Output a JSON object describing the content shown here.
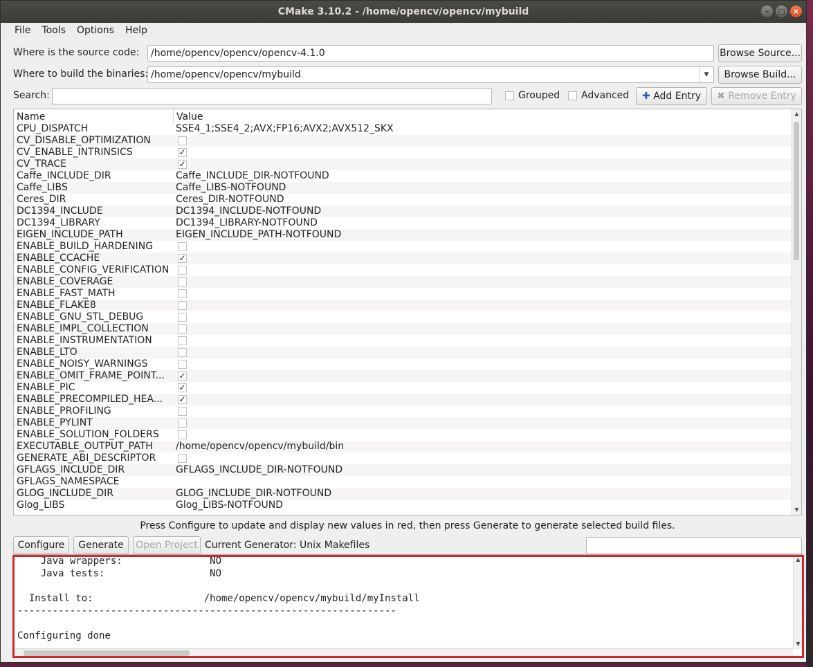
{
  "window": {
    "title": "CMake 3.10.2 - /home/opencv/opencv/mybuild"
  },
  "menu": [
    {
      "label": "File"
    },
    {
      "label": "Tools"
    },
    {
      "label": "Options"
    },
    {
      "label": "Help"
    }
  ],
  "source": {
    "label": "Where is the source code:",
    "value": "/home/opencv/opencv/opencv-4.1.0",
    "browse_label": "Browse Source..."
  },
  "build": {
    "label": "Where to build the binaries:",
    "value": "/home/opencv/opencv/mybuild",
    "browse_label": "Browse Build..."
  },
  "search": {
    "label": "Search:",
    "value": "",
    "grouped_label": "Grouped",
    "grouped_checked": false,
    "advanced_label": "Advanced",
    "advanced_checked": false,
    "add_entry_label": "Add Entry",
    "remove_entry_label": "Remove Entry"
  },
  "table": {
    "columns": [
      "Name",
      "Value"
    ],
    "rows": [
      {
        "name": "CPU_DISPATCH",
        "value": "SSE4_1;SSE4_2;AVX;FP16;AVX2;AVX512_SKX"
      },
      {
        "name": "CV_DISABLE_OPTIMIZATION",
        "checked": false
      },
      {
        "name": "CV_ENABLE_INTRINSICS",
        "checked": true
      },
      {
        "name": "CV_TRACE",
        "checked": true
      },
      {
        "name": "Caffe_INCLUDE_DIR",
        "value": "Caffe_INCLUDE_DIR-NOTFOUND"
      },
      {
        "name": "Caffe_LIBS",
        "value": "Caffe_LIBS-NOTFOUND"
      },
      {
        "name": "Ceres_DIR",
        "value": "Ceres_DIR-NOTFOUND"
      },
      {
        "name": "DC1394_INCLUDE",
        "value": "DC1394_INCLUDE-NOTFOUND"
      },
      {
        "name": "DC1394_LIBRARY",
        "value": "DC1394_LIBRARY-NOTFOUND"
      },
      {
        "name": "EIGEN_INCLUDE_PATH",
        "value": "EIGEN_INCLUDE_PATH-NOTFOUND"
      },
      {
        "name": "ENABLE_BUILD_HARDENING",
        "checked": false
      },
      {
        "name": "ENABLE_CCACHE",
        "checked": true
      },
      {
        "name": "ENABLE_CONFIG_VERIFICATION",
        "checked": false
      },
      {
        "name": "ENABLE_COVERAGE",
        "checked": false
      },
      {
        "name": "ENABLE_FAST_MATH",
        "checked": false
      },
      {
        "name": "ENABLE_FLAKE8",
        "checked": false
      },
      {
        "name": "ENABLE_GNU_STL_DEBUG",
        "checked": false
      },
      {
        "name": "ENABLE_IMPL_COLLECTION",
        "checked": false
      },
      {
        "name": "ENABLE_INSTRUMENTATION",
        "checked": false
      },
      {
        "name": "ENABLE_LTO",
        "checked": false
      },
      {
        "name": "ENABLE_NOISY_WARNINGS",
        "checked": false
      },
      {
        "name": "ENABLE_OMIT_FRAME_POINT...",
        "checked": true
      },
      {
        "name": "ENABLE_PIC",
        "checked": true
      },
      {
        "name": "ENABLE_PRECOMPILED_HEA...",
        "checked": true
      },
      {
        "name": "ENABLE_PROFILING",
        "checked": false
      },
      {
        "name": "ENABLE_PYLINT",
        "checked": false
      },
      {
        "name": "ENABLE_SOLUTION_FOLDERS",
        "checked": false
      },
      {
        "name": "EXECUTABLE_OUTPUT_PATH",
        "value": "/home/opencv/opencv/mybuild/bin"
      },
      {
        "name": "GENERATE_ABI_DESCRIPTOR",
        "checked": false
      },
      {
        "name": "GFLAGS_INCLUDE_DIR",
        "value": "GFLAGS_INCLUDE_DIR-NOTFOUND"
      },
      {
        "name": "GFLAGS_NAMESPACE",
        "value": ""
      },
      {
        "name": "GLOG_INCLUDE_DIR",
        "value": "GLOG_INCLUDE_DIR-NOTFOUND"
      },
      {
        "name": "Glog_LIBS",
        "value": "Glog_LIBS-NOTFOUND"
      }
    ]
  },
  "hint": "Press Configure to update and display new values in red, then press Generate to generate selected build files.",
  "actions": {
    "configure_label": "Configure",
    "generate_label": "Generate",
    "open_project_label": "Open Project",
    "generator_text": "Current Generator: Unix Makefiles"
  },
  "log": {
    "lines": [
      "    Java wrappers:               NO",
      "    Java tests:                  NO",
      "",
      "  Install to:                   /home/opencv/opencv/mybuild/myInstall",
      "-----------------------------------------------------------------",
      "",
      "Configuring done"
    ]
  }
}
